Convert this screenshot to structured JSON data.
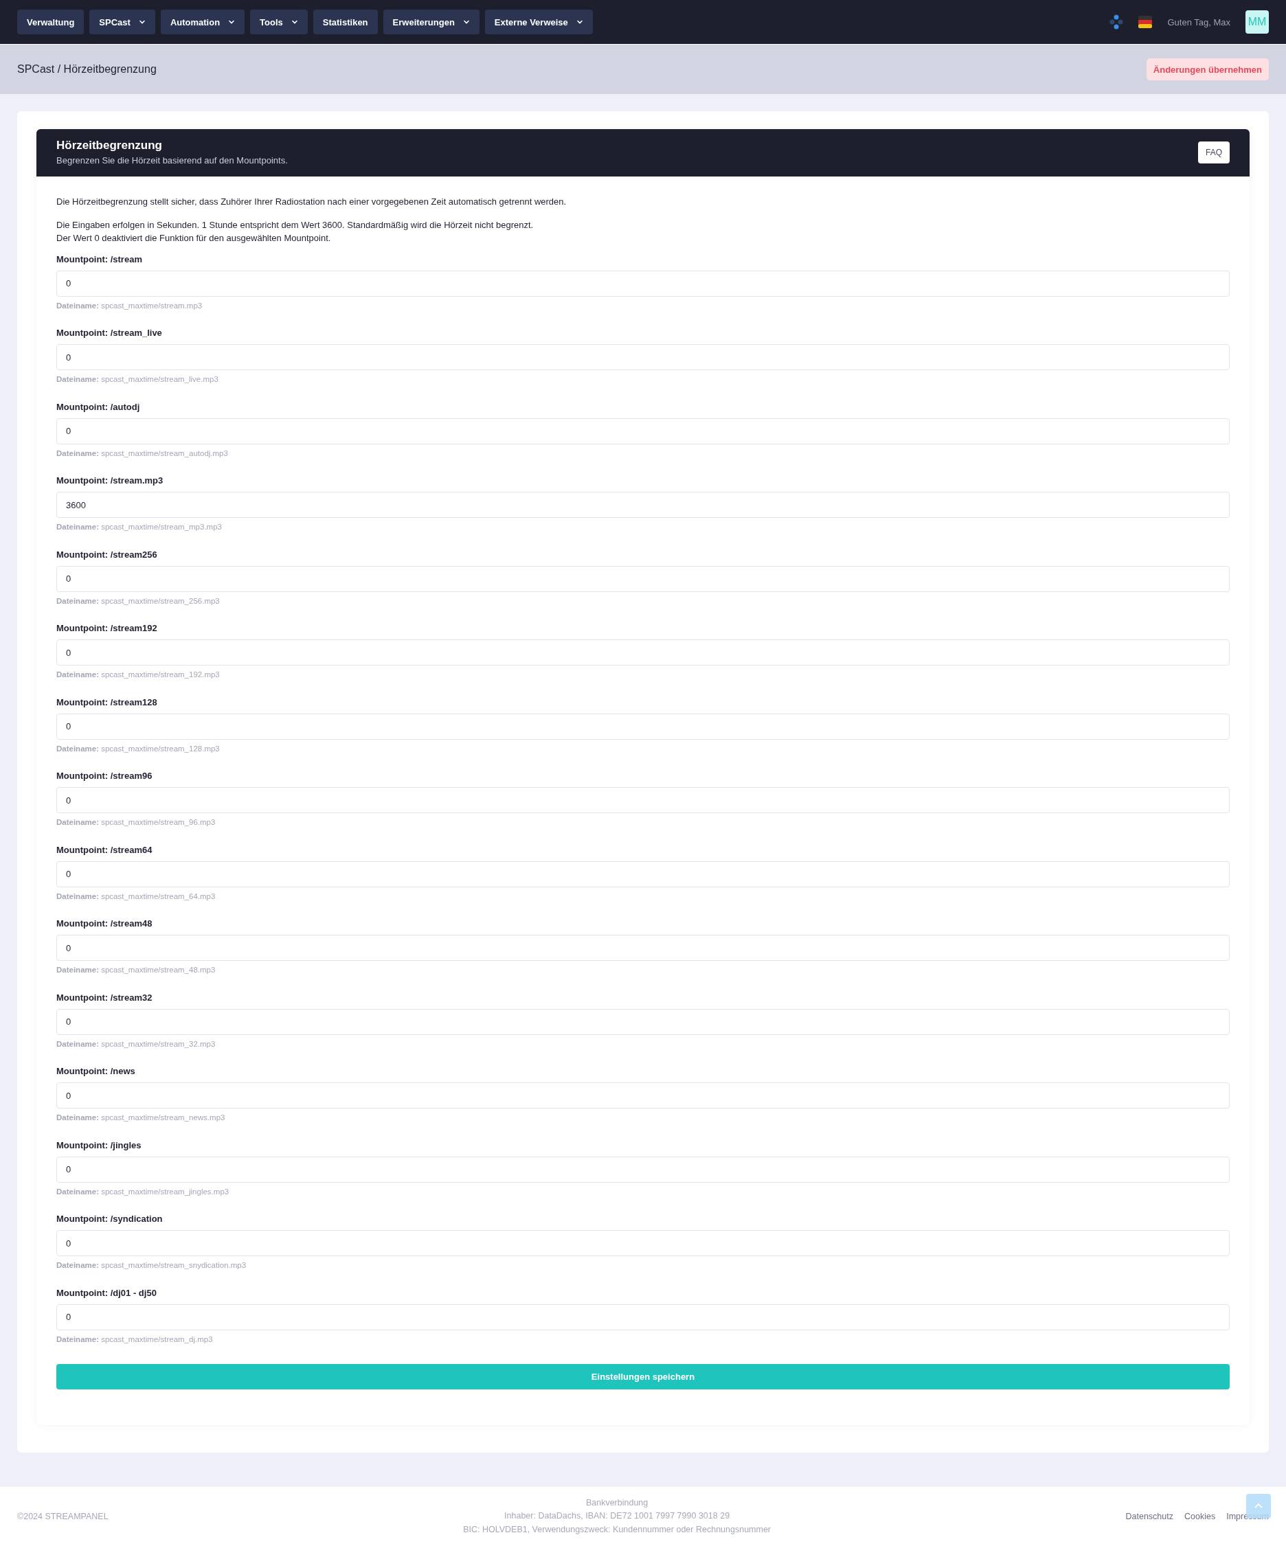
{
  "nav": {
    "items": [
      {
        "label": "Verwaltung",
        "dropdown": false
      },
      {
        "label": "SPCast",
        "dropdown": true
      },
      {
        "label": "Automation",
        "dropdown": true
      },
      {
        "label": "Tools",
        "dropdown": true
      },
      {
        "label": "Statistiken",
        "dropdown": false
      },
      {
        "label": "Erweiterungen",
        "dropdown": true
      },
      {
        "label": "Externe Verweise",
        "dropdown": true
      }
    ],
    "greeting": "Guten Tag, Max",
    "avatar": "MM"
  },
  "breadcrumb": "SPCast / Hörzeitbegrenzung",
  "apply_button": "Änderungen übernehmen",
  "card": {
    "title": "Hörzeitbegrenzung",
    "subtitle": "Begrenzen Sie die Hörzeit basierend auf den Mountpoints.",
    "faq_button": "FAQ",
    "intro": [
      "Die Hörzeitbegrenzung stellt sicher, dass Zuhörer Ihrer Radiostation nach einer vorgegebenen Zeit automatisch getrennt werden.",
      "Die Eingaben erfolgen in Sekunden. 1 Stunde entspricht dem Wert 3600. Standardmäßig wird die Hörzeit nicht begrenzt.",
      "Der Wert 0 deaktiviert die Funktion für den ausgewählten Mountpoint."
    ],
    "fields": [
      {
        "label": "Mountpoint: /stream",
        "value": "0",
        "hint_label": "Dateiname:",
        "hint": "spcast_maxtime/stream.mp3"
      },
      {
        "label": "Mountpoint: /stream_live",
        "value": "0",
        "hint_label": "Dateiname:",
        "hint": "spcast_maxtime/stream_live.mp3"
      },
      {
        "label": "Mountpoint: /autodj",
        "value": "0",
        "hint_label": "Dateiname:",
        "hint": "spcast_maxtime/stream_autodj.mp3"
      },
      {
        "label": "Mountpoint: /stream.mp3",
        "value": "3600",
        "hint_label": "Dateiname:",
        "hint": "spcast_maxtime/stream_mp3.mp3"
      },
      {
        "label": "Mountpoint: /stream256",
        "value": "0",
        "hint_label": "Dateiname:",
        "hint": "spcast_maxtime/stream_256.mp3"
      },
      {
        "label": "Mountpoint: /stream192",
        "value": "0",
        "hint_label": "Dateiname:",
        "hint": "spcast_maxtime/stream_192.mp3"
      },
      {
        "label": "Mountpoint: /stream128",
        "value": "0",
        "hint_label": "Dateiname:",
        "hint": "spcast_maxtime/stream_128.mp3"
      },
      {
        "label": "Mountpoint: /stream96",
        "value": "0",
        "hint_label": "Dateiname:",
        "hint": "spcast_maxtime/stream_96.mp3"
      },
      {
        "label": "Mountpoint: /stream64",
        "value": "0",
        "hint_label": "Dateiname:",
        "hint": "spcast_maxtime/stream_64.mp3"
      },
      {
        "label": "Mountpoint: /stream48",
        "value": "0",
        "hint_label": "Dateiname:",
        "hint": "spcast_maxtime/stream_48.mp3"
      },
      {
        "label": "Mountpoint: /stream32",
        "value": "0",
        "hint_label": "Dateiname:",
        "hint": "spcast_maxtime/stream_32.mp3"
      },
      {
        "label": "Mountpoint: /news",
        "value": "0",
        "hint_label": "Dateiname:",
        "hint": "spcast_maxtime/stream_news.mp3"
      },
      {
        "label": "Mountpoint: /jingles",
        "value": "0",
        "hint_label": "Dateiname:",
        "hint": "spcast_maxtime/stream_jingles.mp3"
      },
      {
        "label": "Mountpoint: /syndication",
        "value": "0",
        "hint_label": "Dateiname:",
        "hint": "spcast_maxtime/stream_snydication.mp3"
      },
      {
        "label": "Mountpoint: /dj01 - dj50",
        "value": "0",
        "hint_label": "Dateiname:",
        "hint": "spcast_maxtime/stream_dj.mp3"
      }
    ],
    "save_button": "Einstellungen speichern"
  },
  "footer": {
    "copyright": "©2024 STREAMPANEL",
    "bank": [
      "Bankverbindung",
      "Inhaber: DataDachs, IBAN: DE72 1001 7997 7990 3018 29",
      "BIC: HOLVDEB1, Verwendungszweck: Kundennummer oder Rechnungsnummer"
    ],
    "links": [
      "Datenschutz",
      "Cookies",
      "Impressum"
    ]
  }
}
